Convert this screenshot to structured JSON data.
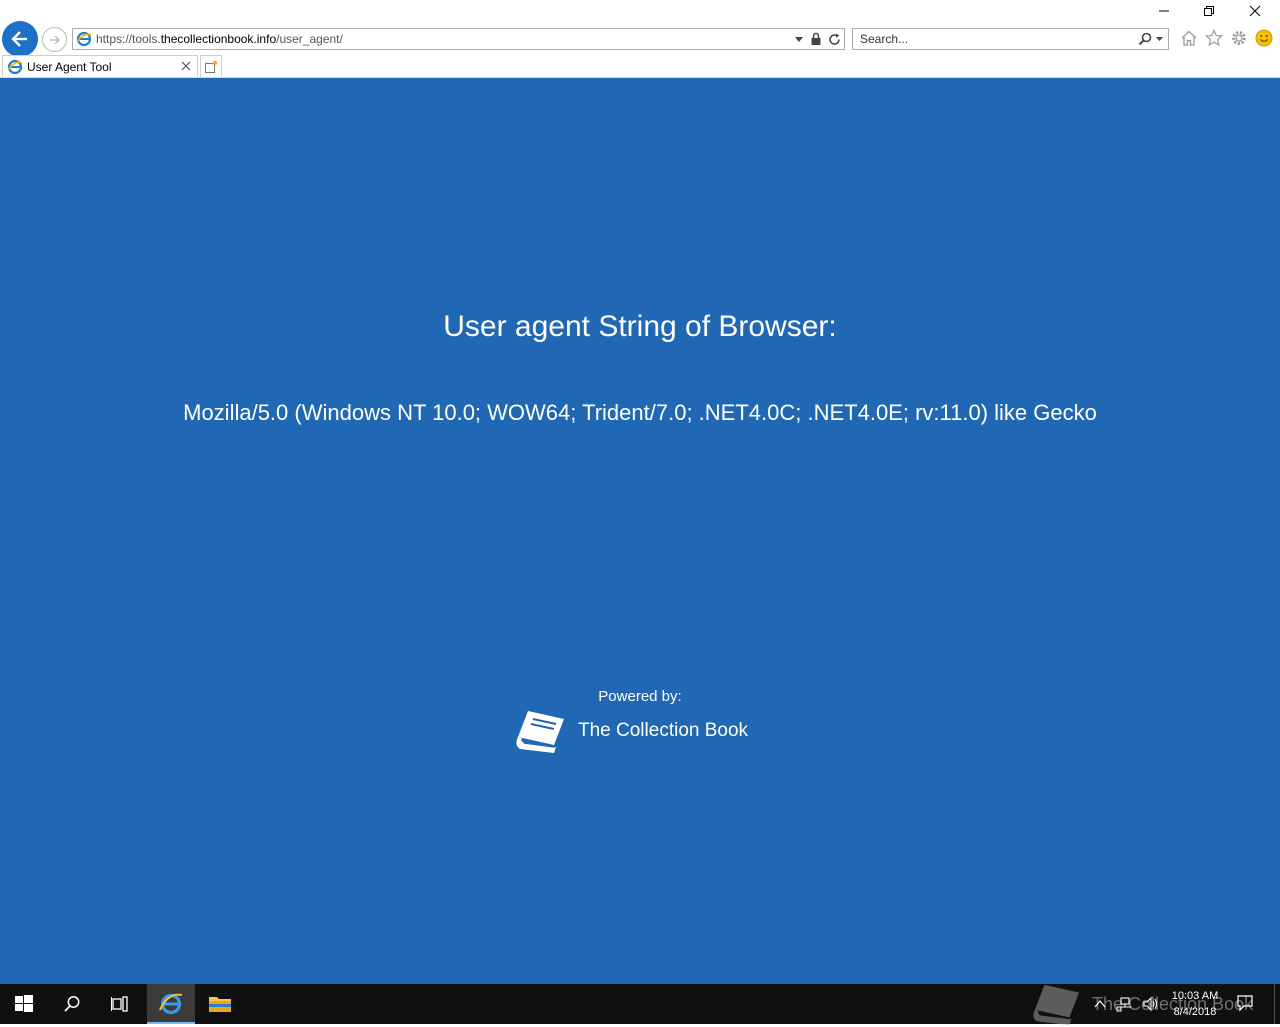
{
  "window": {
    "minimize_label": "minimize",
    "restore_label": "restore",
    "close_label": "close"
  },
  "address_bar": {
    "url_prefix": "https://tools.",
    "url_domain": "thecollectionbook.info",
    "url_path": "/user_agent/"
  },
  "search": {
    "placeholder": "Search..."
  },
  "tab": {
    "title": "User Agent Tool"
  },
  "page": {
    "heading": "User agent String of Browser:",
    "user_agent": "Mozilla/5.0 (Windows NT 10.0; WOW64; Trident/7.0; .NET4.0C; .NET4.0E; rv:11.0) like Gecko",
    "powered_by": "Powered by:",
    "brand_name": "The Collection Book",
    "background_color": "#2068b4"
  },
  "taskbar": {
    "watermark_text": "The Collection Book",
    "clock_time": "10:03 AM",
    "clock_date": "8/4/2018"
  },
  "icons": {
    "back": "back-arrow-icon",
    "forward": "forward-arrow-icon",
    "lock": "lock-icon",
    "refresh": "refresh-icon",
    "home": "home-icon",
    "favorites": "star-icon",
    "settings": "gear-icon",
    "feedback": "smiley-icon"
  }
}
